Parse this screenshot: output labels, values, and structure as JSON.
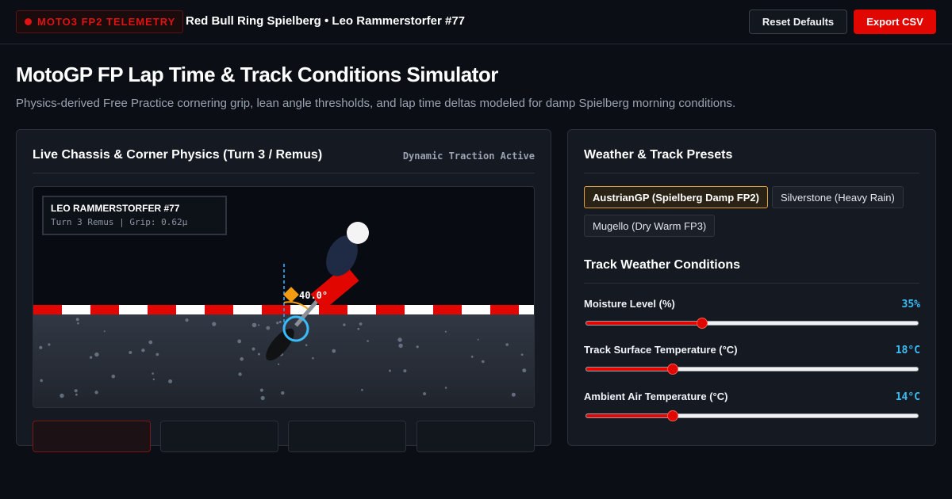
{
  "header": {
    "badge_label": "MOTO3 FP2 TELEMETRY",
    "session_label": "Red Bull Ring Spielberg • Leo Rammerstorfer #77",
    "reset_label": "Reset Defaults",
    "export_label": "Export CSV"
  },
  "page": {
    "title": "MotoGP FP Lap Time & Track Conditions Simulator",
    "subtitle": "Physics-derived Free Practice cornering grip, lean angle thresholds, and lap time deltas modeled for damp Spielberg morning conditions."
  },
  "chassis_panel": {
    "title": "Live Chassis & Corner Physics (Turn 3 / Remus)",
    "status_tag": "Dynamic Traction Active",
    "hud_rider": "LEO RAMMERSTORFER #77",
    "hud_meta": "Turn 3 Remus | Grip: 0.62μ",
    "lean_angle_label": "40.0°",
    "lean_angle_deg": 40.0
  },
  "presets_panel": {
    "title": "Weather & Track Presets",
    "presets": [
      {
        "label": "AustrianGP (Spielberg Damp FP2)",
        "active": true
      },
      {
        "label": "Silverstone (Heavy Rain)",
        "active": false
      },
      {
        "label": "Mugello (Dry Warm FP3)",
        "active": false
      }
    ],
    "conditions_title": "Track Weather Conditions",
    "sliders": [
      {
        "label": "Moisture Level (%)",
        "value_text": "35%",
        "fraction": 0.35
      },
      {
        "label": "Track Surface Temperature (°C)",
        "value_text": "18°C",
        "fraction": 0.26
      },
      {
        "label": "Ambient Air Temperature (°C)",
        "value_text": "14°C",
        "fraction": 0.26
      }
    ]
  },
  "colors": {
    "accent_red": "#e10600",
    "accent_blue": "#38bdf8",
    "preset_active_border": "#e3a33a"
  }
}
